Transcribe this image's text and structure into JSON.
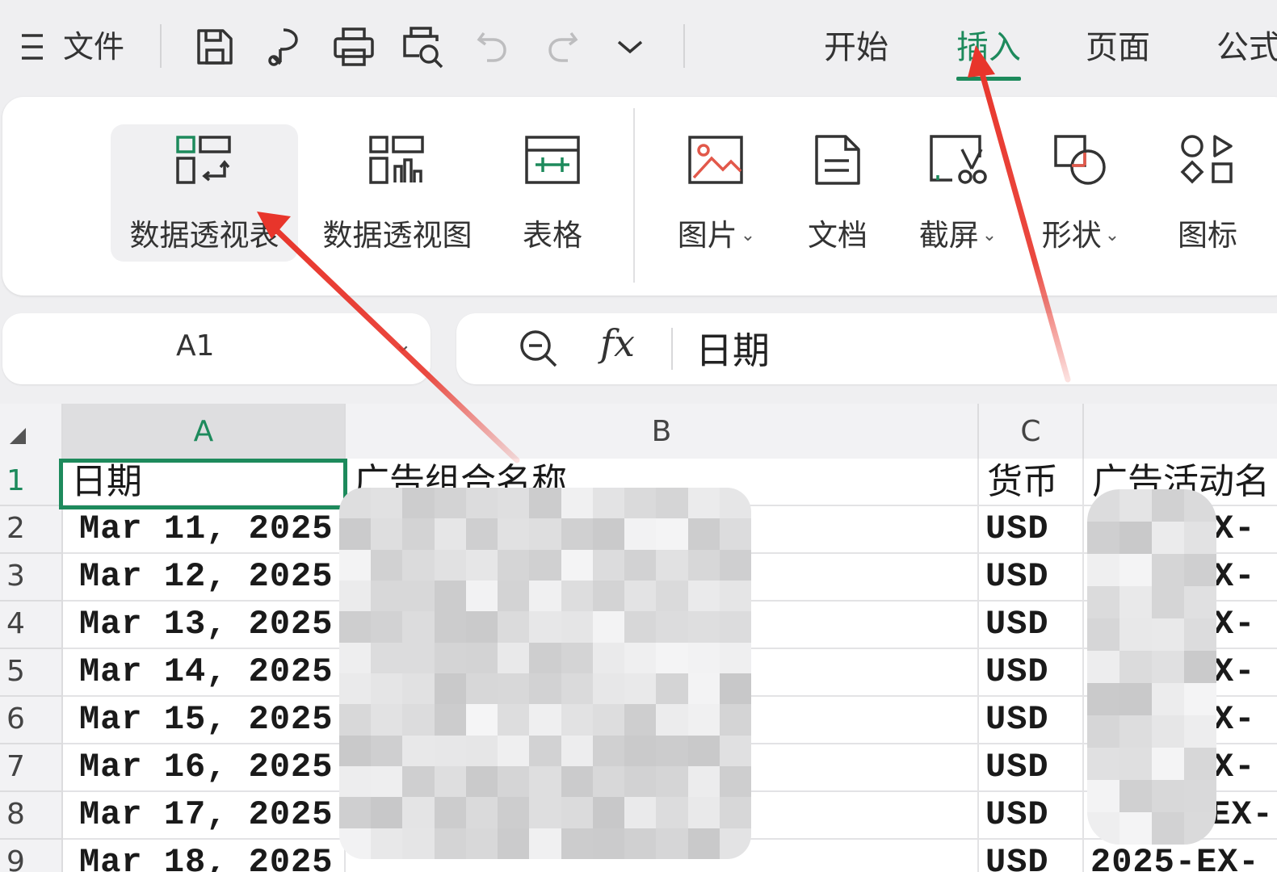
{
  "topbar": {
    "menu_icon": "hamburger-icon",
    "menu_label": "文件",
    "quick_icons": [
      "save-icon",
      "format-painter-icon",
      "print-icon",
      "print-preview-icon",
      "undo-icon",
      "redo-icon",
      "chevron-down-icon"
    ],
    "tabs": [
      {
        "label": "开始",
        "active": false
      },
      {
        "label": "插入",
        "active": true
      },
      {
        "label": "页面",
        "active": false
      },
      {
        "label": "公式",
        "active": false
      }
    ]
  },
  "ribbon": {
    "buttons": [
      {
        "label": "数据透视表",
        "icon": "pivot-table-icon",
        "dropdown": false
      },
      {
        "label": "数据透视图",
        "icon": "pivot-chart-icon",
        "dropdown": false
      },
      {
        "label": "表格",
        "icon": "table-icon",
        "dropdown": false
      },
      {
        "label": "图片",
        "icon": "picture-icon",
        "dropdown": true
      },
      {
        "label": "文档",
        "icon": "document-icon",
        "dropdown": false
      },
      {
        "label": "截屏",
        "icon": "screenshot-icon",
        "dropdown": true
      },
      {
        "label": "形状",
        "icon": "shapes-icon",
        "dropdown": true
      },
      {
        "label": "图标",
        "icon": "icons-icon",
        "dropdown": false
      }
    ],
    "caret": "⌄"
  },
  "formula_bar": {
    "cell_ref": "A1",
    "fx_label": "fx",
    "value": "日期"
  },
  "grid": {
    "columns": [
      "A",
      "B",
      "C"
    ],
    "active_column": "A",
    "rows": [
      "1",
      "2",
      "3",
      "4",
      "5",
      "6",
      "7",
      "8",
      "9"
    ],
    "header_row": {
      "a": "日期",
      "b": "广告组合名称",
      "c": "货币",
      "d": "广告活动名"
    },
    "data": [
      {
        "a": "Mar 11, 2025",
        "c": "USD",
        "d": "X-"
      },
      {
        "a": "Mar 12, 2025",
        "c": "USD",
        "d": "X-"
      },
      {
        "a": "Mar 13, 2025",
        "c": "USD",
        "d": "X-"
      },
      {
        "a": "Mar 14, 2025",
        "c": "USD",
        "d": "X-"
      },
      {
        "a": "Mar 15, 2025",
        "c": "USD",
        "d": "X-"
      },
      {
        "a": "Mar 16, 2025",
        "c": "USD",
        "d": "X-"
      },
      {
        "a": "Mar 17, 2025",
        "c": "USD",
        "d": "-EX-"
      },
      {
        "a": "Mar 18, 2025",
        "c": "USD",
        "d": "2025-EX-"
      }
    ]
  },
  "colors": {
    "accent": "#1d8a5c",
    "annotation": "#e8352b"
  }
}
